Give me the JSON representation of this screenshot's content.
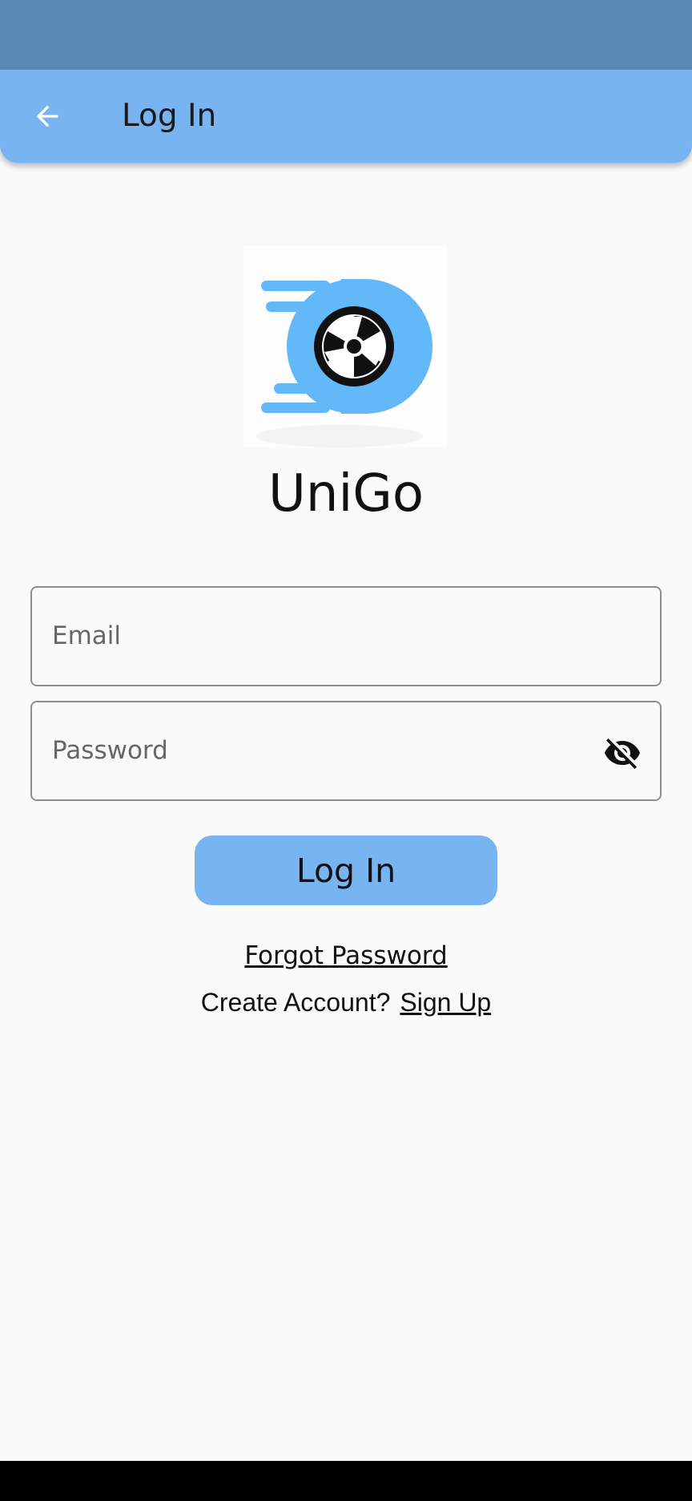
{
  "app_bar": {
    "title": "Log In",
    "back_icon": "arrow-back-icon"
  },
  "brand": {
    "logo_icon": "unigo-wheel-logo",
    "name": "UniGo"
  },
  "form": {
    "email": {
      "placeholder": "Email",
      "value": ""
    },
    "password": {
      "placeholder": "Password",
      "value": "",
      "toggle_icon": "visibility-off-icon"
    },
    "login_label": "Log In",
    "forgot_label": "Forgot Password",
    "create_account_text": "Create Account?",
    "signup_label": "Sign Up"
  },
  "colors": {
    "status_bar": "#5b89b5",
    "app_bar": "#78b3f2",
    "accent": "#78b3f2",
    "logo_blue": "#63b8f7",
    "background": "#fafafa"
  }
}
